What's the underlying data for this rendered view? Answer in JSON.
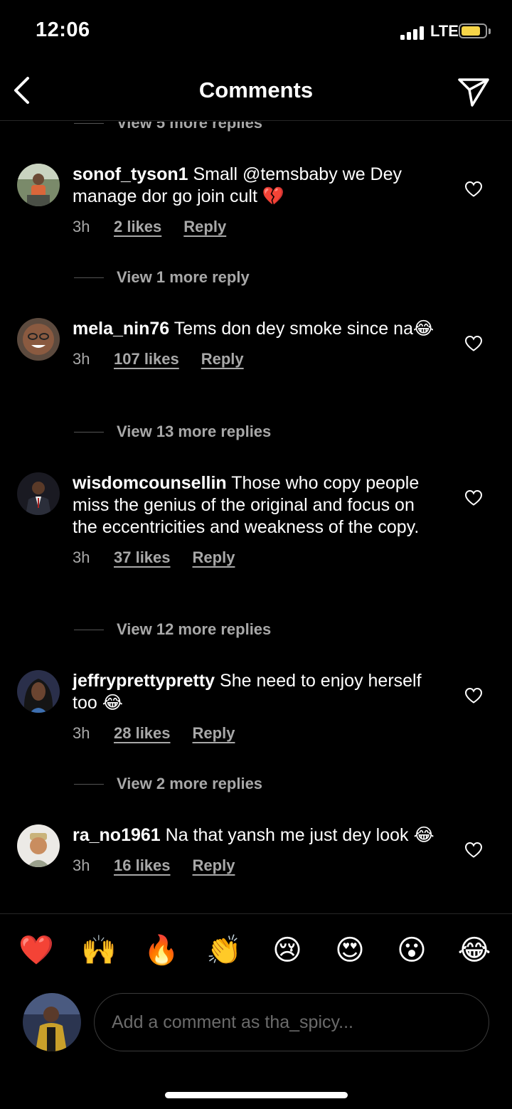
{
  "status": {
    "time": "12:06",
    "network": "LTE"
  },
  "nav": {
    "title": "Comments"
  },
  "comments": [
    {
      "username": "sonof_tyson1",
      "text": "Small @temsbaby  we Dey manage dor go join cult",
      "emoji": "💔",
      "time": "3h",
      "likes": "2 likes",
      "reply": "Reply"
    },
    {
      "username": "mela_nin76",
      "text": "Tems don dey smoke since na",
      "emoji": "😂",
      "time": "3h",
      "likes": "107 likes",
      "reply": "Reply"
    },
    {
      "username": "wisdomcounsellin",
      "text": "Those who copy people miss the genius of the original and focus on the eccentricities and weakness of the copy.",
      "emoji": "",
      "time": "3h",
      "likes": "37 likes",
      "reply": "Reply"
    },
    {
      "username": "jeffryprettypretty",
      "text": "She need to enjoy herself too",
      "emoji": "😂",
      "time": "3h",
      "likes": "28 likes",
      "reply": "Reply"
    },
    {
      "username": "ra_no1961",
      "text": "Na that yansh me just dey look",
      "emoji": "😂",
      "time": "3h",
      "likes": "16 likes",
      "reply": "Reply"
    }
  ],
  "view_replies": [
    "View 5 more replies",
    "View 1 more reply",
    "View 13 more replies",
    "View 12 more replies",
    "View 2 more replies"
  ],
  "reactions": [
    "❤️",
    "🙌",
    "🔥",
    "👏",
    "😢",
    "😍",
    "😮",
    "😂"
  ],
  "compose": {
    "placeholder": "Add a comment as tha_spicy..."
  },
  "colors": {
    "background": "#000000",
    "text": "#ffffff",
    "secondary": "#a8a8a8",
    "divider": "#262626",
    "battery": "#f7d548"
  }
}
